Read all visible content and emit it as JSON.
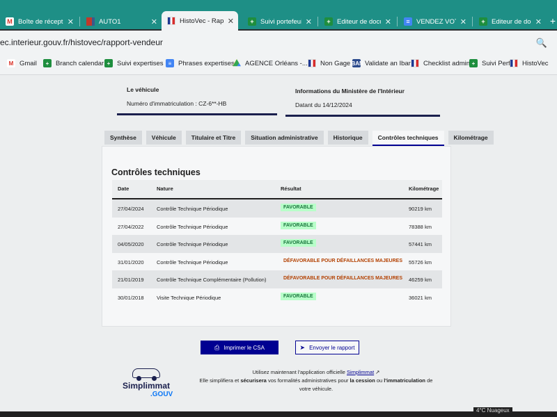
{
  "browser": {
    "tabs": [
      {
        "title": "Boîte de récepti",
        "icon": "gmail-icon"
      },
      {
        "title": "AUTO1",
        "icon": "auto1-icon"
      },
      {
        "title": "HistoVec - Rappo",
        "icon": "french-flag-icon",
        "active": true
      },
      {
        "title": "Suivi portefeuille",
        "icon": "sheets-icon"
      },
      {
        "title": "Editeur de docu",
        "icon": "sheets-icon"
      },
      {
        "title": "VENDEZ VOTRE",
        "icon": "docs-icon"
      },
      {
        "title": "Editeur de docu",
        "icon": "sheets-icon"
      }
    ],
    "close_glyph": "✕",
    "new_tab_glyph": "+",
    "url": "ec.interieur.gouv.fr/histovec/rapport-vendeur",
    "zoom_glyph": "🔍",
    "bookmarks": [
      {
        "label": "Gmail",
        "icon": "gmail-icon"
      },
      {
        "label": "Branch calendar",
        "icon": "sheets-icon"
      },
      {
        "label": "Suivi expertises",
        "icon": "sheets-icon"
      },
      {
        "label": "Phrases expertises",
        "icon": "docs-icon"
      },
      {
        "label": "AGENCE Orléans -...",
        "icon": "drive-icon"
      },
      {
        "label": "Non Gage",
        "icon": "french-flag-icon"
      },
      {
        "label": "Validate an Iban",
        "icon": "iban-icon"
      },
      {
        "label": "Checklist admin",
        "icon": "french-flag-icon"
      },
      {
        "label": "Suivi Perf",
        "icon": "sheets-icon"
      },
      {
        "label": "HistoVec",
        "icon": "french-flag-icon"
      }
    ]
  },
  "vehicle_card": {
    "title": "Le véhicule",
    "plate_line": "Numéro d'immatriculation : CZ-6**-HB"
  },
  "ministry_card": {
    "title": "Informations du Ministère de l'Intérieur",
    "date_line": "Datant du 14/12/2024"
  },
  "report_tabs": [
    {
      "label": "Synthèse"
    },
    {
      "label": "Véhicule"
    },
    {
      "label": "Titulaire et Titre"
    },
    {
      "label": "Situation administrative"
    },
    {
      "label": "Historique"
    },
    {
      "label": "Contrôles techniques",
      "active": true
    },
    {
      "label": "Kilométrage"
    }
  ],
  "section": {
    "title": "Contrôles techniques",
    "columns": {
      "date": "Date",
      "nature": "Nature",
      "result": "Résultat",
      "km": "Kilométrage"
    },
    "rows": [
      {
        "date": "27/04/2024",
        "nature": "Contrôle Technique Périodique",
        "result": "FAVORABLE",
        "status": "ok",
        "km": "90219 km"
      },
      {
        "date": "27/04/2022",
        "nature": "Contrôle Technique Périodique",
        "result": "FAVORABLE",
        "status": "ok",
        "km": "78388 km"
      },
      {
        "date": "04/05/2020",
        "nature": "Contrôle Technique Périodique",
        "result": "FAVORABLE",
        "status": "ok",
        "km": "57441 km"
      },
      {
        "date": "31/01/2020",
        "nature": "Contrôle Technique Périodique",
        "result": "DÉFAVORABLE POUR DÉFAILLANCES MAJEURES",
        "status": "ko",
        "km": "55726 km"
      },
      {
        "date": "21/01/2019",
        "nature": "Contrôle Technique Complémentaire (Pollution)",
        "result": "DÉFAVORABLE POUR DÉFAILLANCES MAJEURES",
        "status": "ko",
        "km": "46259 km"
      },
      {
        "date": "30/01/2018",
        "nature": "Visite Technique Périodique",
        "result": "FAVORABLE",
        "status": "ok",
        "km": "36021 km"
      }
    ]
  },
  "actions": {
    "print_label": "Imprimer le CSA",
    "send_label": "Envoyer le rapport"
  },
  "promo": {
    "brand": "Simplimmat",
    "brand_suffix": ".GOUV",
    "line1_prefix": "Utilisez maintenant l'application officielle ",
    "link": "Simplimmat",
    "line2_a": "Elle simplifiera et ",
    "bold1": "sécurisera",
    "line2_b": " vos formalités administratives pour ",
    "bold2": "la cession",
    "line2_c": " ou ",
    "bold3": "l'immatriculation",
    "line2_d": " de votre véhicule."
  },
  "taskbar": {
    "weather": "4°C  Nuageux"
  },
  "colors": {
    "tabstrip": "#1e8f86",
    "marianne_blue": "#000091",
    "favorable_bg": "#b8fec9",
    "favorable_text": "#18753c",
    "defavorable_text": "#b34000"
  }
}
